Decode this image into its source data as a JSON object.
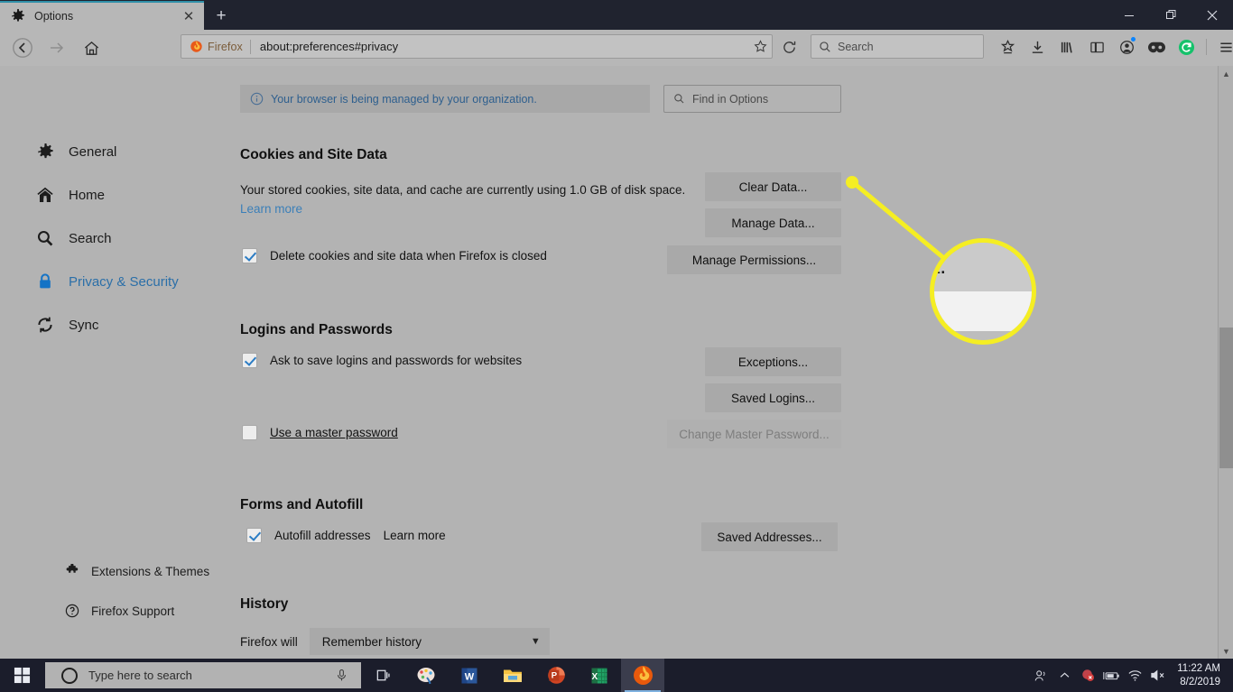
{
  "window": {
    "tab": {
      "title": "Options",
      "favicon": "gear-icon",
      "close": "✕"
    },
    "newtab": "+",
    "controls": {
      "minimize": "—",
      "restore": "❐",
      "close": "✕"
    }
  },
  "toolbar": {
    "back": "back-arrow-icon",
    "forward": "forward-arrow-icon",
    "home": "home-icon",
    "identity_label": "Firefox",
    "url": "about:preferences#privacy",
    "bookmark_star": "star-icon",
    "reload": "reload-icon",
    "search_placeholder": "Search",
    "icons": [
      "pocket-icon",
      "download-icon",
      "library-icon",
      "sidebar-icon",
      "account-icon",
      "container-mask-icon",
      "grammarly-icon",
      "hamburger-menu-icon"
    ]
  },
  "sidebar": {
    "items": [
      {
        "label": "General",
        "icon": "gear-icon",
        "active": false
      },
      {
        "label": "Home",
        "icon": "home-icon",
        "active": false
      },
      {
        "label": "Search",
        "icon": "search-icon",
        "active": false
      },
      {
        "label": "Privacy & Security",
        "icon": "lock-icon",
        "active": true
      },
      {
        "label": "Sync",
        "icon": "sync-icon",
        "active": false
      }
    ],
    "bottom": [
      {
        "label": "Extensions & Themes",
        "icon": "puzzle-piece-icon"
      },
      {
        "label": "Firefox Support",
        "icon": "question-circle-icon"
      }
    ]
  },
  "main": {
    "notice": "Your browser is being managed by your organization.",
    "find_placeholder": "Find in Options",
    "cookies": {
      "title": "Cookies and Site Data",
      "description_line1": "Your stored cookies, site data, and cache are currently using 1.0 GB of disk",
      "description_line2": "space.",
      "learn_more": "Learn more",
      "usage": "1.0 GB",
      "checkbox_label": "Delete cookies and site data when Firefox is closed",
      "checkbox_checked": true,
      "buttons": {
        "clear": "Clear Data...",
        "manage": "Manage Data...",
        "permissions": "Manage Permissions..."
      }
    },
    "logins": {
      "title": "Logins and Passwords",
      "ask_label": "Ask to save logins and passwords for websites",
      "ask_checked": true,
      "master_label": "Use a master password",
      "master_checked": false,
      "buttons": {
        "exceptions": "Exceptions...",
        "saved_logins": "Saved Logins...",
        "change_master": "Change Master Password..."
      }
    },
    "forms": {
      "title": "Forms and Autofill",
      "autofill_label": "Autofill addresses",
      "autofill_checked": true,
      "learn_more": "Learn more",
      "saved_addresses": "Saved Addresses..."
    },
    "history": {
      "title": "History",
      "label": "Firefox will",
      "selected": "Remember history"
    }
  },
  "callout": {
    "magnified_text": "Clear Data.",
    "ring_color": "#f5ee23"
  },
  "taskbar": {
    "start": "windows-logo-icon",
    "search_placeholder": "Type here to search",
    "mic": "microphone-icon",
    "taskview": "task-view-icon",
    "apps": [
      "paint-icon",
      "word-icon",
      "file-explorer-icon",
      "powerpoint-icon",
      "excel-icon",
      "firefox-icon"
    ],
    "tray": [
      "people-icon",
      "chevron-up-icon",
      "notification-icon",
      "battery-icon",
      "wifi-icon",
      "speaker-muted-icon"
    ],
    "time": "11:22 AM",
    "date": "8/2/2019"
  }
}
